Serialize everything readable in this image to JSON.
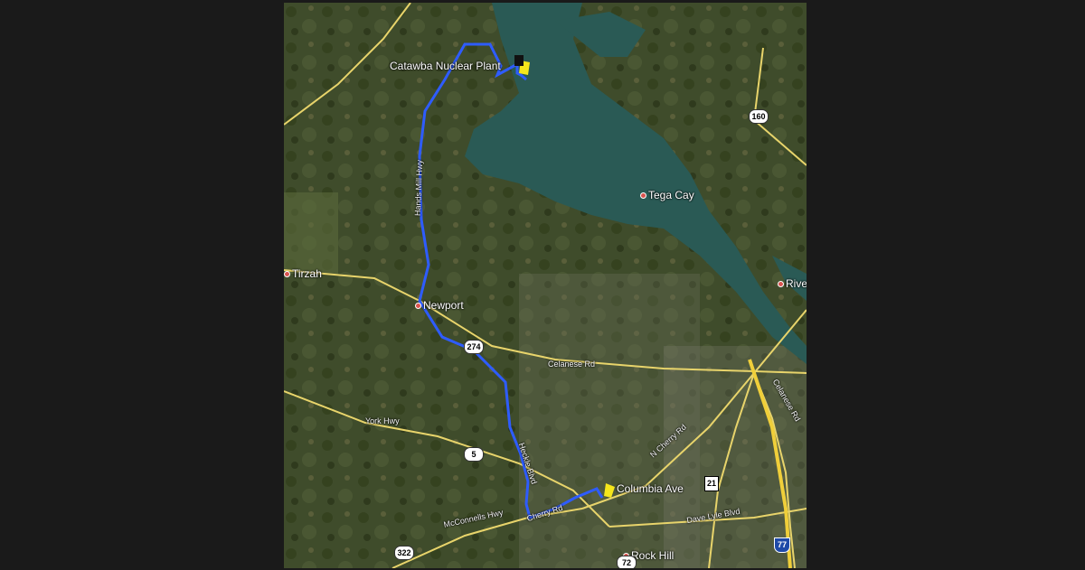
{
  "places": {
    "catawba": "Catawba Nuclear Plant",
    "tega_cay": "Tega Cay",
    "tirzah": "Tirzah",
    "newport": "Newport",
    "columbia_ave": "Columbia Ave",
    "rock_hill": "Rock Hill",
    "river": "Rive"
  },
  "roads": {
    "hands_mill": "Hands Mill Hwy",
    "celanese": "Celanese Rd",
    "york_hwy": "York Hwy",
    "heckle": "Heckle Blvd",
    "cherry": "Cherry Rd",
    "mcconnells": "McConnells Hwy",
    "mcherry": "N Cherry Rd",
    "dave_lyle": "Dave Lyle Blvd",
    "celanese_r": "Celanese Rd"
  },
  "shields": {
    "sc160": "160",
    "sc274": "274",
    "sc5": "5",
    "sc322": "322",
    "us21": "21",
    "sc72": "72",
    "i77": "77"
  },
  "colors": {
    "route": "#2e5cff",
    "marker": "#f5e61b",
    "water": "#2a5a55",
    "roads": "#e8d46b"
  }
}
